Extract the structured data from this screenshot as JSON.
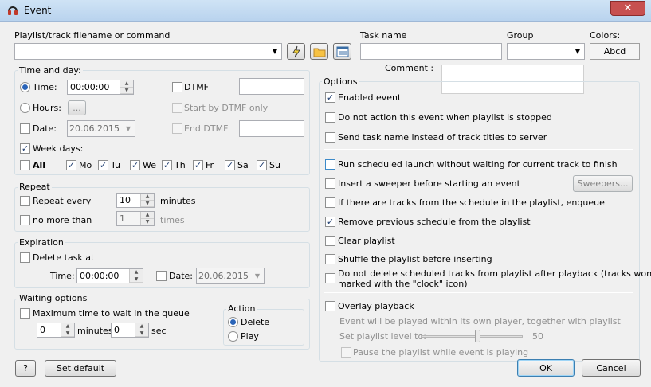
{
  "window": {
    "title": "Event",
    "close_glyph": "✕"
  },
  "top": {
    "playlist_label": "Playlist/track filename or command",
    "playlist_value": "",
    "task_name_label": "Task name",
    "group_label": "Group",
    "colors_label": "Colors:",
    "colors_button": "Abcd",
    "comment_label": "Comment :"
  },
  "time_day": {
    "legend": "Time and day:",
    "time_label": "Time:",
    "time_value": "00:00:00",
    "dtmf_label": "DTMF",
    "hours_label": "Hours:",
    "hours_button": "...",
    "start_dtmf_label": "Start by DTMF only",
    "date_label": "Date:",
    "date_value": "20.06.2015",
    "end_dtmf_label": "End DTMF",
    "week_days_label": "Week days:",
    "all_label": "All",
    "days": [
      "Mo",
      "Tu",
      "We",
      "Th",
      "Fr",
      "Sa",
      "Su"
    ]
  },
  "repeat": {
    "legend": "Repeat",
    "repeat_every_label": "Repeat every",
    "repeat_value": "10",
    "minutes_label": "minutes",
    "no_more_label": "no more than",
    "no_more_value": "1",
    "times_label": "times"
  },
  "expiration": {
    "legend": "Expiration",
    "delete_task_label": "Delete task at",
    "time_label": "Time:",
    "time_value": "00:00:00",
    "date_label": "Date:",
    "date_value": "20.06.2015"
  },
  "waiting": {
    "legend": "Waiting options",
    "max_time_label": "Maximum time to wait in the queue",
    "minutes_value": "0",
    "minutes_label": "minutes",
    "sec_value": "0",
    "sec_label": "sec",
    "action_legend": "Action",
    "delete_label": "Delete",
    "play_label": "Play"
  },
  "options": {
    "legend": "Options",
    "enabled_event": "Enabled event",
    "do_not_action": "Do not action this event when playlist is stopped",
    "send_task_name": "Send task name instead of track titles to server",
    "run_scheduled": "Run scheduled launch without waiting for current track to finish",
    "insert_sweeper": "Insert a sweeper before starting an event",
    "sweepers_button": "Sweepers...",
    "if_tracks": "If there are tracks from the schedule in the playlist, enqueue",
    "remove_previous": "Remove previous schedule from the playlist",
    "clear_playlist": "Clear playlist",
    "shuffle": "Shuffle the playlist before inserting",
    "do_not_delete_1": "Do not delete scheduled tracks from playlist after playback (tracks won't be",
    "do_not_delete_2": "marked with the \"clock\" icon)",
    "overlay": "Overlay playback",
    "overlay_desc": "Event will be played within its own player, together with playlist",
    "set_level_label": "Set playlist level to:",
    "level_value": "50",
    "pause_playlist": "Pause the playlist while event is playing"
  },
  "footer": {
    "help_button": "?",
    "set_default_button": "Set default",
    "ok_button": "OK",
    "cancel_button": "Cancel"
  },
  "check_glyph": "✓"
}
